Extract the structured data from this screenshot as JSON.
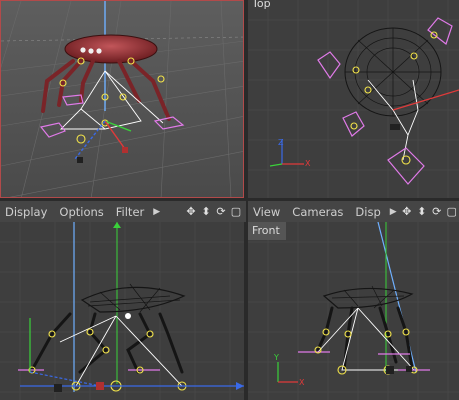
{
  "viewports": {
    "top": {
      "label": "Top"
    },
    "front": {
      "label": "Front"
    }
  },
  "toolbar_left": {
    "menus": [
      "Display",
      "Options",
      "Filter"
    ]
  },
  "toolbar_right": {
    "menus": [
      "View",
      "Cameras",
      "Disp"
    ]
  },
  "icons": {
    "play": "play-icon",
    "move": "move-icon",
    "scale": "scale-icon",
    "rotate": "rotate-icon",
    "maximize": "maximize-icon"
  },
  "colors": {
    "selection_border": "#b24a4a",
    "grid_bg": "#3e3e3e",
    "wire": "#ffffff",
    "joint": "#f2e34a",
    "control": "#e07ae8",
    "axis_x": "#e03a3a",
    "axis_y": "#3ad13a",
    "axis_z": "#3a6ae8"
  }
}
